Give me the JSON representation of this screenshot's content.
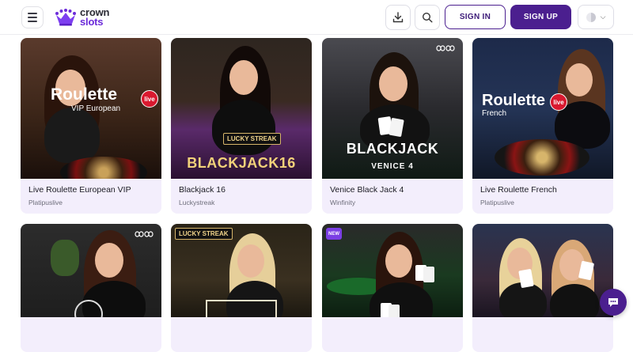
{
  "header": {
    "menu_icon": "hamburger-icon",
    "logo": {
      "line1": "crown",
      "line2": "slots",
      "icon": "crown-icon"
    },
    "download_icon": "download-icon",
    "search_icon": "search-icon",
    "signin_label": "SIGN IN",
    "signup_label": "SIGN UP",
    "language_icon": "flag-icon",
    "language_chevron": "chevron-down-icon"
  },
  "games": [
    {
      "title": "Live Roulette European VIP",
      "provider": "Platipuslive",
      "art_title": "Roulette",
      "art_sub": "VIP European",
      "badge": "live"
    },
    {
      "title": "Blackjack 16",
      "provider": "Luckystreak",
      "art_title": "BLACKJACK16",
      "art_logo": "LUCKY STREAK"
    },
    {
      "title": "Venice Black Jack 4",
      "provider": "Winfinity",
      "art_title": "BLACKJACK",
      "art_sub": "VENICE 4"
    },
    {
      "title": "Live Roulette French",
      "provider": "Platipuslive",
      "art_title": "Roulette",
      "art_sub": "French",
      "badge": "live"
    },
    {
      "title": "",
      "provider": ""
    },
    {
      "title": "",
      "provider": "",
      "art_logo": "LUCKY STREAK"
    },
    {
      "title": "",
      "provider": "",
      "badge": "NEW"
    },
    {
      "title": "",
      "provider": ""
    }
  ],
  "colors": {
    "brand": "#4b1f8f",
    "card_bg": "#f3eefc",
    "live_red": "#d9192f"
  },
  "chat_icon": "chat-icon"
}
